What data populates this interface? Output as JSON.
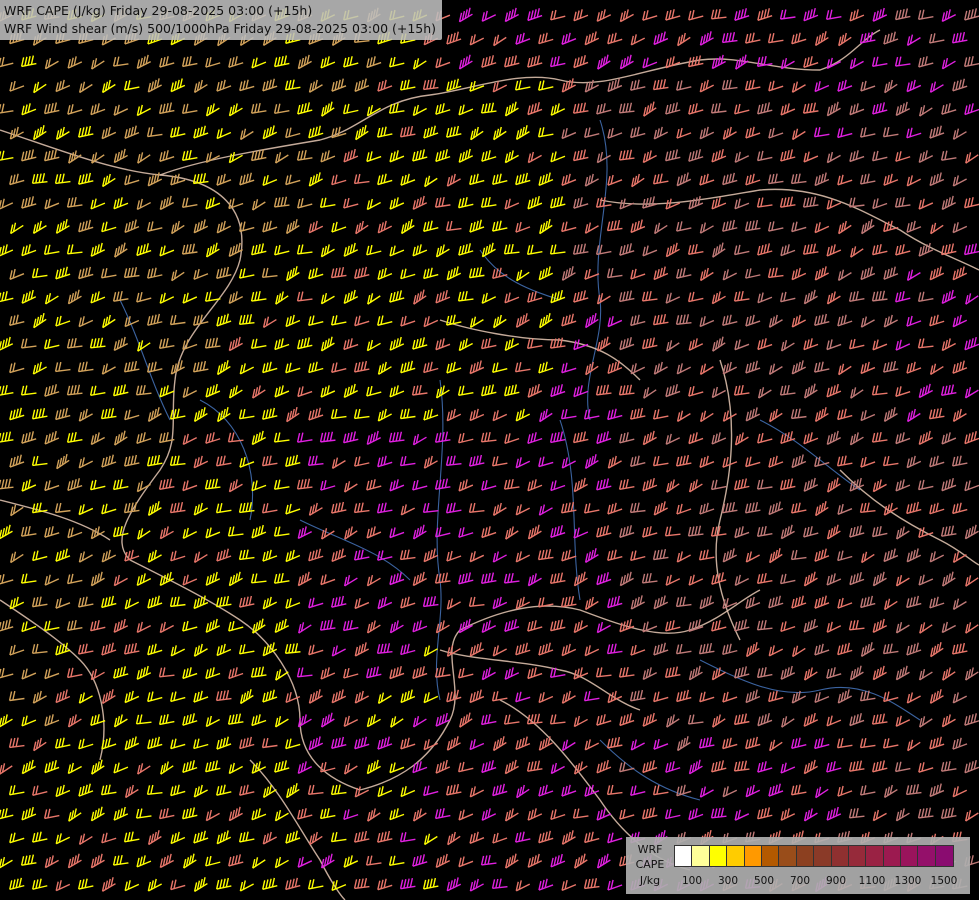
{
  "titles": {
    "line1": "WRF CAPE (J/kg) Friday 29-08-2025 03:00 (+15h)",
    "line2": "WRF Wind shear (m/s) 500/1000hPa Friday 29-08-2025 03:00 (+15h)"
  },
  "legend": {
    "label_line1": "WRF",
    "label_line2": "CAPE",
    "label_line3": "J/kg",
    "swatch_colors": [
      "#ffffff",
      "#ffff99",
      "#ffff00",
      "#ffcc00",
      "#ff9900",
      "#b35900",
      "#994d1a",
      "#8c4020",
      "#8a3a28",
      "#8f3030",
      "#962a3a",
      "#9a2244",
      "#9c1a50",
      "#9a145c",
      "#94106a",
      "#8a0c70"
    ],
    "tick_labels": [
      "100",
      "300",
      "500",
      "700",
      "900",
      "1100",
      "1300",
      "1500"
    ]
  },
  "barb_colors": {
    "yellow": "#ffff00",
    "tan": "#d2a25a",
    "salmon": "#e8766a",
    "pinkish_brown": "#c07a78",
    "magenta": "#e020e0"
  },
  "border_colors": {
    "country": "#e6c8b4",
    "river": "#4a7cc8"
  }
}
